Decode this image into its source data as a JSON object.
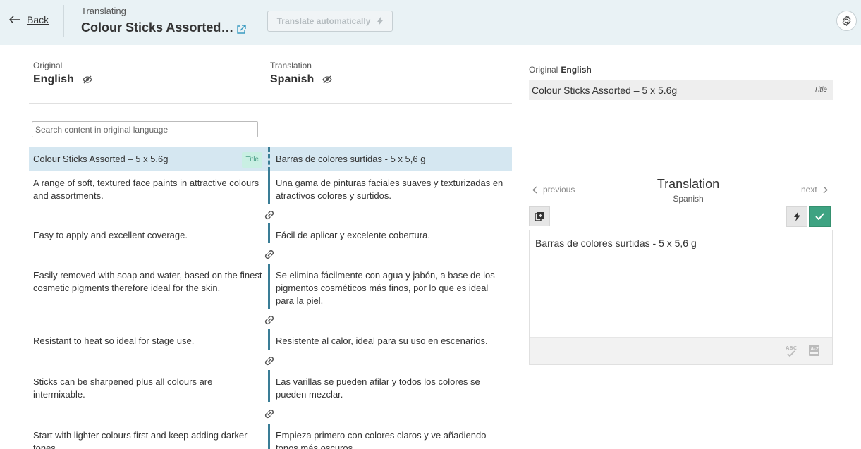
{
  "header": {
    "back_label": "Back",
    "translating_label": "Translating",
    "document_title": "Colour Sticks Assorted…",
    "translate_auto_label": "Translate automatically"
  },
  "columns": {
    "original": {
      "caption": "Original",
      "language": "English"
    },
    "translation": {
      "caption": "Translation",
      "language": "Spanish"
    }
  },
  "search": {
    "placeholder": "Search content in original language"
  },
  "segments": [
    {
      "source": "Colour Sticks Assorted – 5 x 5.6g",
      "target": "Barras de colores surtidas - 5 x 5,6 g",
      "badge": "Title"
    },
    {
      "source": "A range of soft, textured face paints in attractive colours and assortments.",
      "target": "Una gama de pinturas faciales suaves y texturizadas en atractivos colores y surtidos."
    },
    {
      "source": "Easy to apply and excellent coverage.",
      "target": "Fácil de aplicar y excelente cobertura."
    },
    {
      "source": "Easily removed with soap and water, based on the finest cosmetic pigments therefore ideal for the skin.",
      "target": "Se elimina fácilmente con agua y jabón, a base de los pigmentos cosméticos más finos, por lo que es ideal para la piel."
    },
    {
      "source": "Resistant to heat so ideal for stage use.",
      "target": "Resistente al calor, ideal para su uso en escenarios."
    },
    {
      "source": "Sticks can be sharpened plus all colours are intermixable.",
      "target": "Las varillas se pueden afilar y todos los colores se pueden mezclar."
    },
    {
      "source": "Start with lighter colours first and keep adding darker tones.",
      "target": "Empieza primero con colores claros y ve añadiendo tonos más oscuros."
    }
  ],
  "panel": {
    "original_caption": "Original",
    "original_language": "English",
    "original_text": "Colour Sticks Assorted – 5 x 5.6g",
    "original_tag": "Title",
    "previous_label": "previous",
    "next_label": "next",
    "title": "Translation",
    "language": "Spanish",
    "editor_text": "Barras de colores surtidas - 5 x 5,6 g"
  },
  "colors": {
    "header_bg": "#e9f2f5",
    "accent": "#3a7d96",
    "active_row": "#d5e7f1",
    "confirm": "#3ea382"
  }
}
